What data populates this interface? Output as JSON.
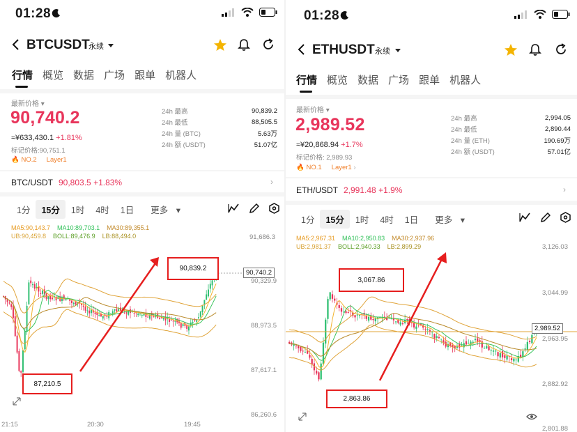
{
  "left": {
    "time": "01:28",
    "symbol": "BTCUSDT",
    "perp_label": "永续",
    "tabs": [
      "行情",
      "概览",
      "数据",
      "广场",
      "跟单",
      "机器人"
    ],
    "last_price_label": "最新价格",
    "price": "90,740.2",
    "cny": "≈¥633,430.1",
    "change": "+1.81%",
    "mark_price": "标记价格:90,751.1",
    "rank": "NO.2",
    "layer": "Layer1",
    "stats": [
      {
        "k": "24h  最高",
        "v": "90,839.2"
      },
      {
        "k": "24h  最低",
        "v": "88,505.5"
      },
      {
        "k": "24h  量 (BTC)",
        "v": "5.63万"
      },
      {
        "k": "24h  额 (USDT)",
        "v": "51.07亿"
      }
    ],
    "pair": "BTC/USDT",
    "pair_price": "90,803.5",
    "pair_change": "+1.83%",
    "intervals": [
      "1分",
      "15分",
      "1时",
      "4时",
      "1日",
      "更多"
    ],
    "ma5": "MA5:90,143.7",
    "ma10": "MA10:89,703.1",
    "ma30": "MA30:89,355.1",
    "ub": "UB:90,459.8",
    "boll": "BOLL:89,476.9",
    "lb": "LB:88,494.0",
    "yticks": [
      "91,686.3",
      "90,329.9",
      "88,973.5",
      "87,617.1",
      "86,260.6"
    ],
    "xticks": [
      "21:15",
      "20:30",
      "19:45"
    ],
    "current_tag": "90,740.2",
    "callout_high": "90,839.2",
    "callout_low": "87,210.5"
  },
  "right": {
    "time": "01:28",
    "symbol": "ETHUSDT",
    "perp_label": "永续",
    "tabs": [
      "行情",
      "概览",
      "数据",
      "广场",
      "跟单",
      "机器人"
    ],
    "last_price_label": "最新价格",
    "price": "2,989.52",
    "cny": "≈¥20,868.94",
    "change": "+1.7%",
    "mark_price": "标记价格: 2,989.93",
    "rank": "NO.1",
    "layer": "Layer1",
    "stats": [
      {
        "k": "24h  最高",
        "v": "2,994.05"
      },
      {
        "k": "24h  最低",
        "v": "2,890.44"
      },
      {
        "k": "24h  量 (ETH)",
        "v": "190.69万"
      },
      {
        "k": "24h  额 (USDT)",
        "v": "57.01亿"
      }
    ],
    "pair": "ETH/USDT",
    "pair_price": "2,991.48",
    "pair_change": "+1.9%",
    "intervals": [
      "1分",
      "15分",
      "1时",
      "4时",
      "1日",
      "更多"
    ],
    "ma5": "MA5:2,967.31",
    "ma10": "MA10:2,950.83",
    "ma30": "MA30:2,937.96",
    "ub": "UB:2,981.37",
    "boll": "BOLL:2,940.33",
    "lb": "LB:2,899.29",
    "yticks": [
      "3,126.03",
      "3,044.99",
      "2,963.95",
      "2,882.92",
      "2,801.88"
    ],
    "current_tag": "2,989.52",
    "callout_high": "3,067.86",
    "callout_low": "2,863.86"
  },
  "colors": {
    "up": "#2fbf71",
    "down": "#e8355b",
    "accent": "#f4b400",
    "annot": "#e61e1e"
  }
}
